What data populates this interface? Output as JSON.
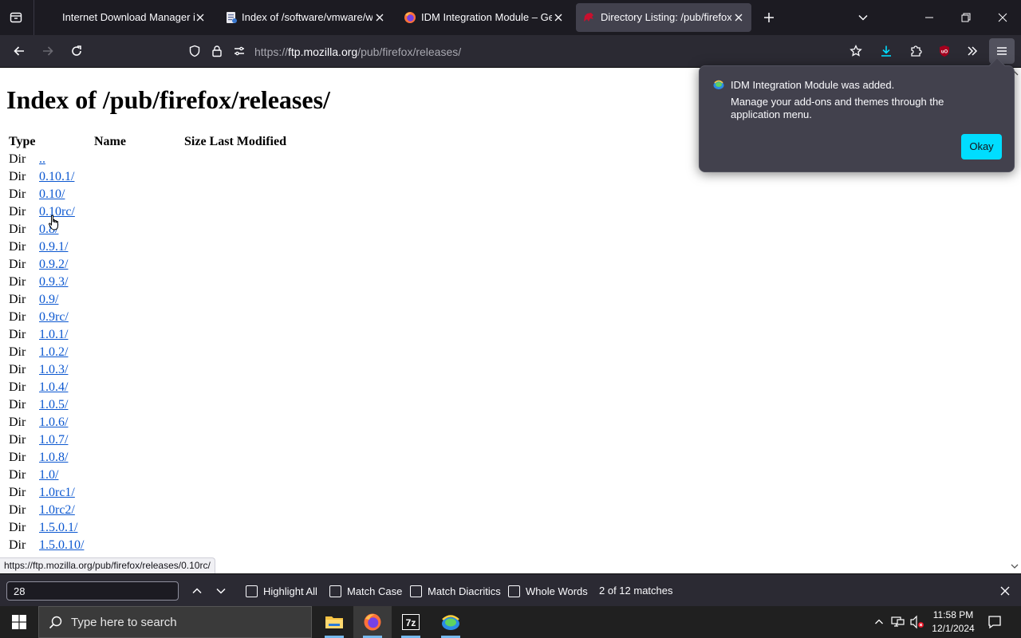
{
  "browser": {
    "tabs": [
      {
        "title": "Internet Download Manager is c"
      },
      {
        "title": "Index of /software/vmware/wo"
      },
      {
        "title": "IDM Integration Module – Get t"
      },
      {
        "title": "Directory Listing: /pub/firefox/r"
      }
    ],
    "active_tab": 3,
    "url": {
      "scheme": "https://",
      "host": "ftp.mozilla.org",
      "path": "/pub/firefox/releases/"
    }
  },
  "page": {
    "heading": "Index of /pub/firefox/releases/",
    "columns": {
      "type": "Type",
      "name": "Name",
      "size_modified": "Size Last Modified"
    },
    "rows": [
      {
        "type": "Dir",
        "name": ".."
      },
      {
        "type": "Dir",
        "name": "0.10.1/"
      },
      {
        "type": "Dir",
        "name": "0.10/"
      },
      {
        "type": "Dir",
        "name": "0.10rc/"
      },
      {
        "type": "Dir",
        "name": "0.8/"
      },
      {
        "type": "Dir",
        "name": "0.9.1/"
      },
      {
        "type": "Dir",
        "name": "0.9.2/"
      },
      {
        "type": "Dir",
        "name": "0.9.3/"
      },
      {
        "type": "Dir",
        "name": "0.9/"
      },
      {
        "type": "Dir",
        "name": "0.9rc/"
      },
      {
        "type": "Dir",
        "name": "1.0.1/"
      },
      {
        "type": "Dir",
        "name": "1.0.2/"
      },
      {
        "type": "Dir",
        "name": "1.0.3/"
      },
      {
        "type": "Dir",
        "name": "1.0.4/"
      },
      {
        "type": "Dir",
        "name": "1.0.5/"
      },
      {
        "type": "Dir",
        "name": "1.0.6/"
      },
      {
        "type": "Dir",
        "name": "1.0.7/"
      },
      {
        "type": "Dir",
        "name": "1.0.8/"
      },
      {
        "type": "Dir",
        "name": "1.0/"
      },
      {
        "type": "Dir",
        "name": "1.0rc1/"
      },
      {
        "type": "Dir",
        "name": "1.0rc2/"
      },
      {
        "type": "Dir",
        "name": "1.5.0.1/"
      },
      {
        "type": "Dir",
        "name": "1.5.0.10/"
      }
    ],
    "status_link": "https://ftp.mozilla.org/pub/firefox/releases/0.10rc/"
  },
  "notification": {
    "title": "IDM Integration Module was added.",
    "body": "Manage your add-ons and themes through the application menu.",
    "button": "Okay"
  },
  "findbar": {
    "query": "28",
    "highlight_all": "Highlight All",
    "match_case": "Match Case",
    "match_diacritics": "Match Diacritics",
    "whole_words": "Whole Words",
    "status": "2 of 12 matches"
  },
  "taskbar": {
    "search_placeholder": "Type here to search",
    "time": "11:58 PM",
    "date": "12/1/2024"
  },
  "colors": {
    "link": "#0b57d0",
    "accent_button": "#00ddff",
    "chrome_dark": "#1c1b22",
    "toolbar": "#2b2a33"
  }
}
